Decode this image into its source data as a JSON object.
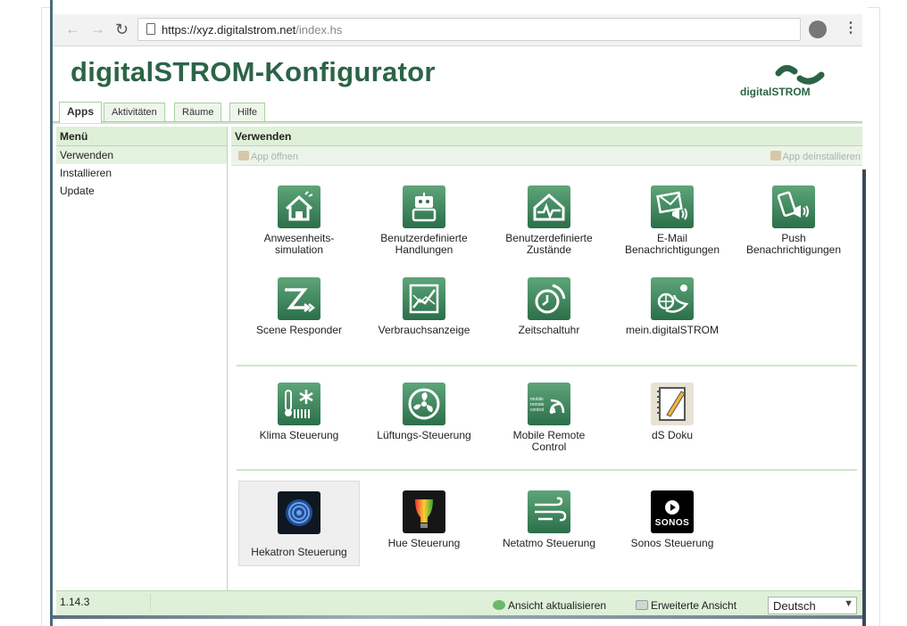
{
  "browser": {
    "url_host": "https://xyz.digitalstrom.net",
    "url_path": "/index.hs",
    "menu_glyph": "⋮"
  },
  "app": {
    "title": "digitalSTROM-Konfigurator",
    "logo_text": "digitalSTROM",
    "brand_color": "#2b6446"
  },
  "tabs": [
    {
      "label": "Apps",
      "active": true
    },
    {
      "label": "Aktivitäten",
      "active": false
    },
    {
      "label": "Räume",
      "active": false
    },
    {
      "label": "Hilfe",
      "active": false
    }
  ],
  "left_panel": {
    "header": "Menü",
    "items": [
      {
        "label": "Verwenden",
        "selected": true
      },
      {
        "label": "Installieren",
        "selected": false
      },
      {
        "label": "Update",
        "selected": false
      }
    ]
  },
  "right_panel": {
    "header": "Verwenden",
    "toolbar": {
      "open_label": "App öffnen",
      "uninstall_label": "App deinstallieren"
    },
    "groups": [
      {
        "apps": [
          {
            "label": "Anwesenheits-\nsimulation",
            "icon": "house-icon"
          },
          {
            "label": "Benutzerdefinierte\nHandlungen",
            "icon": "robot-icon"
          },
          {
            "label": "Benutzerdefinierte\nZustände",
            "icon": "heartbeat-house-icon"
          },
          {
            "label": "E-Mail\nBenachrichtigungen",
            "icon": "email-speaker-icon"
          },
          {
            "label": "Push\nBenachrichtigungen",
            "icon": "phone-speaker-icon"
          },
          {
            "label": "Scene Responder",
            "icon": "scene-responder-icon"
          },
          {
            "label": "Verbrauchsanzeige",
            "icon": "chart-icon"
          },
          {
            "label": "Zeitschaltuhr",
            "icon": "clock-icon"
          },
          {
            "label": "mein.digitalSTROM",
            "icon": "globe-icon"
          }
        ]
      },
      {
        "apps": [
          {
            "label": "Klima Steuerung",
            "icon": "thermo-snow-icon"
          },
          {
            "label": "Lüftungs-Steuerung",
            "icon": "fan-icon"
          },
          {
            "label": "Mobile Remote\nControl",
            "icon": "mobile-remote-icon",
            "icon_text": "mobile remote control"
          },
          {
            "label": "dS Doku",
            "icon": "notebook-icon"
          }
        ]
      },
      {
        "apps": [
          {
            "label": "Hekatron Steuerung",
            "icon": "hekatron-icon",
            "highlighted": true
          },
          {
            "label": "Hue Steuerung",
            "icon": "hue-bulb-icon"
          },
          {
            "label": "Netatmo Steuerung",
            "icon": "wind-icon"
          },
          {
            "label": "Sonos Steuerung",
            "icon": "sonos-icon",
            "icon_text": "SONOS"
          }
        ]
      }
    ]
  },
  "footer": {
    "version": "1.14.3",
    "refresh_label": "Ansicht aktualisieren",
    "advanced_label": "Erweiterte Ansicht",
    "language": "Deutsch"
  }
}
